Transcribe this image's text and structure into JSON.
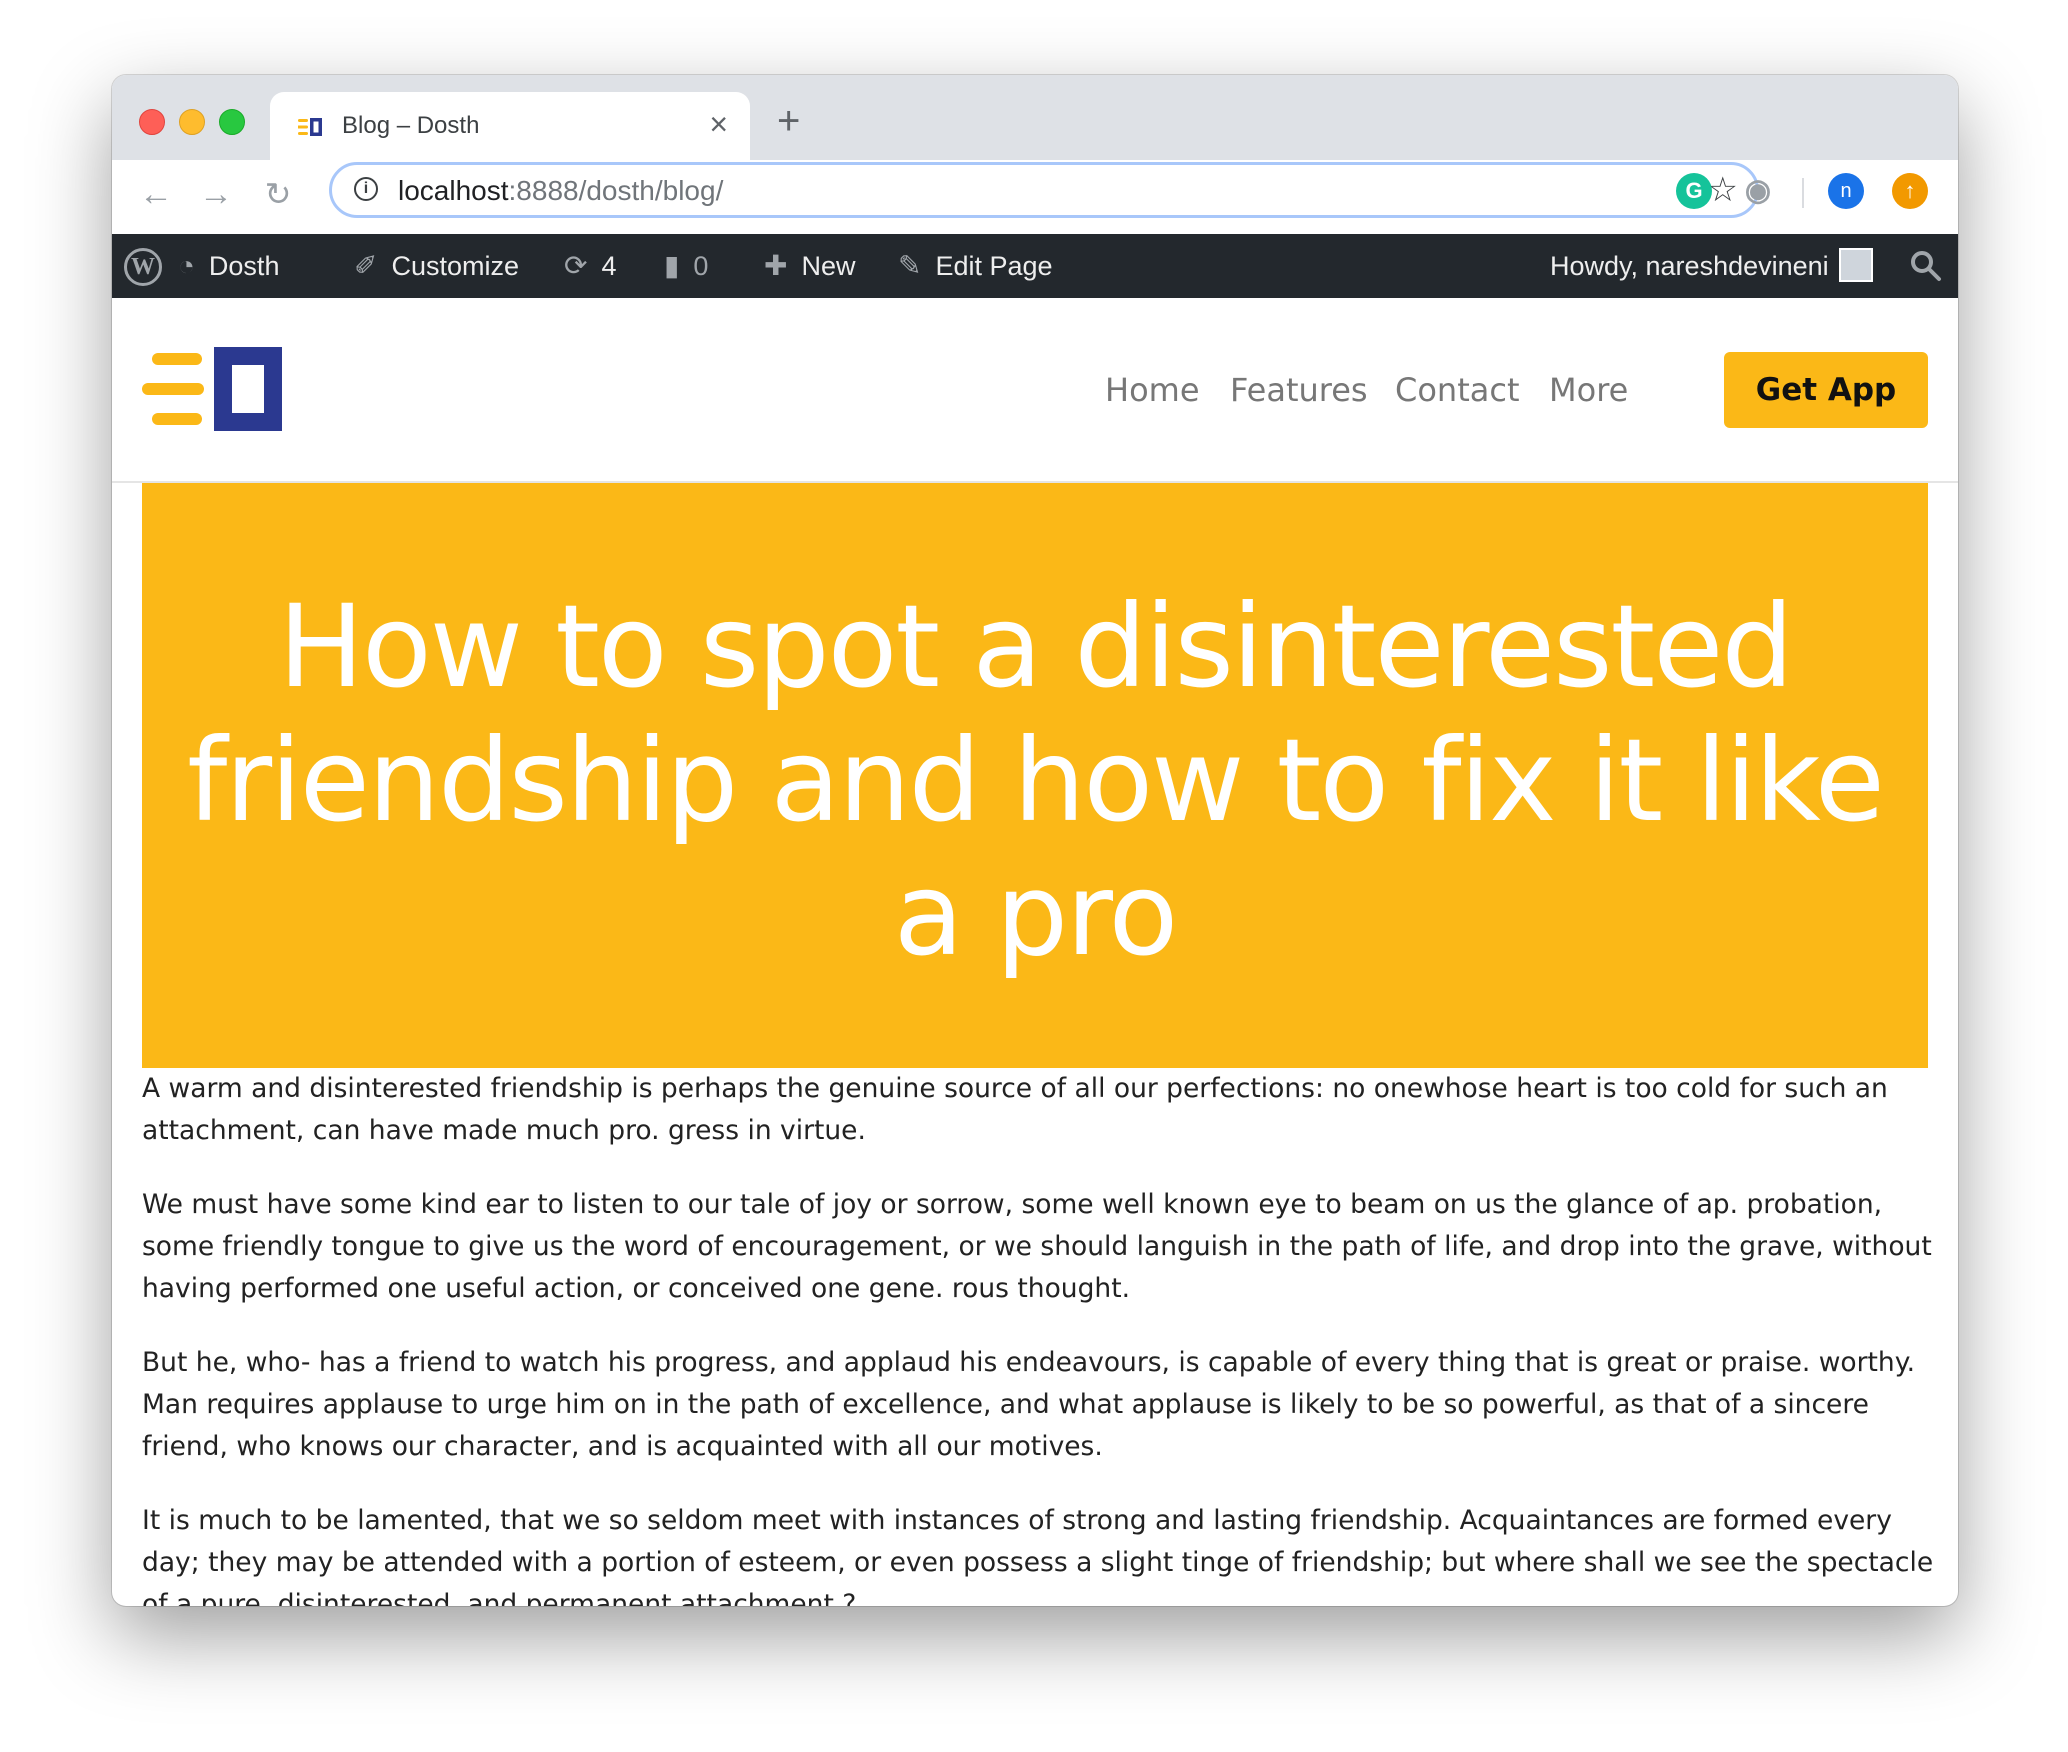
{
  "browser": {
    "tab_title": "Blog – Dosth",
    "tab_close": "×",
    "new_tab": "+",
    "url_host": "localhost",
    "url_path": ":8888/dosth/blog/",
    "nav_icons": [
      "back-arrow-icon",
      "forward-arrow-icon",
      "reload-icon"
    ],
    "extensions": [
      "grammarly-icon",
      "camera-icon",
      "profile-avatar",
      "update-icon"
    ],
    "profile_initial": "n"
  },
  "adminbar": {
    "site_name": "Dosth",
    "customize": "Customize",
    "updates_count": "4",
    "comments_count": "0",
    "new_label": "New",
    "edit_page": "Edit Page",
    "howdy": "Howdy, nareshdevineni"
  },
  "site": {
    "nav": [
      "Home",
      "Features",
      "Contact",
      "More"
    ],
    "cta": "Get App",
    "colors": {
      "accent": "#fbb817",
      "brand_blue": "#2b3990",
      "adminbar": "#23282d"
    }
  },
  "post": {
    "title": "How to spot a disinterested friendship and how to fix it like a pro",
    "paragraphs": [
      "A warm and disinterested friendship is perhaps the genuine source of all our perfections: no onewhose heart is too cold for such an attachment, can have made much pro. gress in virtue.",
      "We must have some kind ear to listen to our tale of joy or sorrow, some well known eye to beam on us the glance of ap. probation, some friendly tongue to give us the word of encouragement, or we should languish in the path of life, and drop into the grave, without having performed one useful action, or conceived one gene. rous thought.",
      "But he, who- has a friend to watch his progress, and applaud his endeavours, is capable of every thing that is great or praise. worthy. Man requires applause to urge him on in the path of excellence, and what applause is likely to be so powerful, as that of a sincere friend, who knows our character, and is acquainted with all our motives.",
      "It is much to be lamented, that we so seldom meet with instances of strong and lasting friendship. Acquaintances are formed every day; they may be attended with a portion of esteem, or even possess a slight tinge of friendship; but where shall we see the spectacle of a pure, disinterested, and permanent attachment ?"
    ]
  }
}
